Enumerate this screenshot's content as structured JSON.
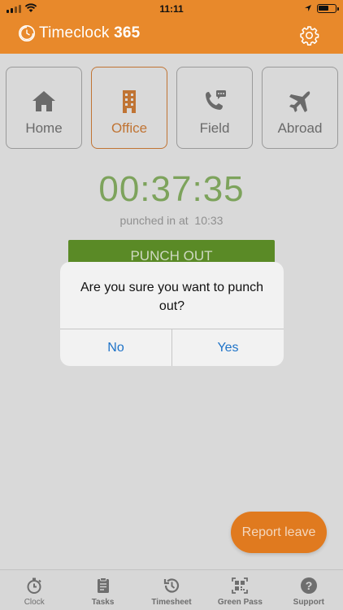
{
  "status_bar": {
    "time": "11:11"
  },
  "header": {
    "brand_prefix": "Timeclock",
    "brand_suffix": "365"
  },
  "modes": [
    {
      "label": "Home",
      "icon": "home-icon",
      "active": false
    },
    {
      "label": "Office",
      "icon": "office-building-icon",
      "active": true
    },
    {
      "label": "Field",
      "icon": "field-phone-icon",
      "active": false
    },
    {
      "label": "Abroad",
      "icon": "airplane-icon",
      "active": false
    }
  ],
  "clock": {
    "elapsed": "00:37:35",
    "punched_in_label": "punched in at",
    "punched_in_time": "10:33",
    "punch_button_label": "PUNCH OUT"
  },
  "dialog": {
    "message": "Are you sure you want to punch out?",
    "no_label": "No",
    "yes_label": "Yes"
  },
  "report_leave_label": "Report leave",
  "tabs": [
    {
      "label": "Clock",
      "icon": "stopwatch-icon"
    },
    {
      "label": "Tasks",
      "icon": "clipboard-icon"
    },
    {
      "label": "Timesheet",
      "icon": "history-icon"
    },
    {
      "label": "Green Pass",
      "icon": "qr-code-icon"
    },
    {
      "label": "Support",
      "icon": "help-icon"
    }
  ],
  "colors": {
    "brand_orange": "#e8892b",
    "active_mode": "#c07434",
    "timer_green": "#7da35c",
    "punch_button": "#5a8a26",
    "dialog_action": "#1e73c8",
    "report_leave": "#e07a1f"
  }
}
